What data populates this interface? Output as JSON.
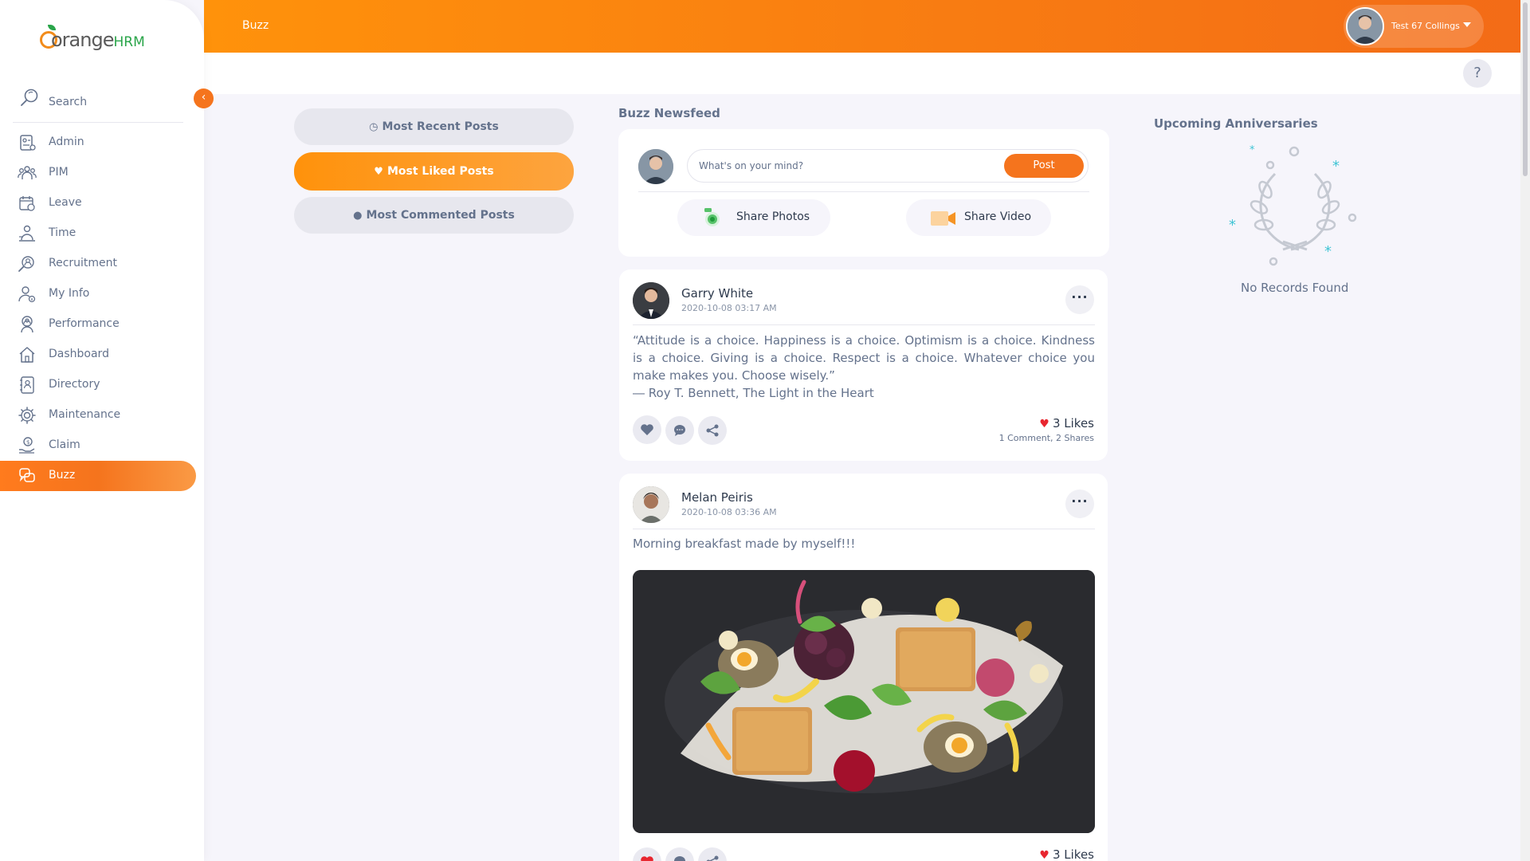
{
  "brand": {
    "logo_text": "orange",
    "logo_suffix": "HRM"
  },
  "sidebar": {
    "search_label": "Search",
    "items": [
      {
        "label": "Admin"
      },
      {
        "label": "PIM"
      },
      {
        "label": "Leave"
      },
      {
        "label": "Time"
      },
      {
        "label": "Recruitment"
      },
      {
        "label": "My Info"
      },
      {
        "label": "Performance"
      },
      {
        "label": "Dashboard"
      },
      {
        "label": "Directory"
      },
      {
        "label": "Maintenance"
      },
      {
        "label": "Claim"
      },
      {
        "label": "Buzz",
        "active": true
      }
    ]
  },
  "topbar": {
    "title": "Buzz",
    "user_name": "Test 67 Collings",
    "help": "?"
  },
  "filters": {
    "recent": "Most Recent Posts",
    "liked": "Most Liked Posts",
    "commented": "Most Commented Posts",
    "active": "liked"
  },
  "newsfeed": {
    "title": "Buzz Newsfeed",
    "placeholder": "What's on your mind?",
    "post_label": "Post",
    "share_photos": "Share Photos",
    "share_video": "Share Video"
  },
  "posts": [
    {
      "author": "Garry White",
      "date": "2020-10-08 03:17 AM",
      "text": "“Attitude is a choice. Happiness is a choice. Optimism is a choice. Kindness is a choice. Giving is a choice. Respect is a choice. Whatever choice you make makes you. Choose wisely.”",
      "attribution": "― Roy T. Bennett, The Light in the Heart",
      "likes": "3 Likes",
      "comments": "1 Comment",
      "shares": "2 Shares"
    },
    {
      "author": "Melan Peiris",
      "date": "2020-10-08 03:36 AM",
      "text": "Morning breakfast made by myself!!!",
      "likes": "3 Likes"
    }
  ],
  "anniversaries": {
    "title": "Upcoming Anniversaries",
    "empty": "No Records Found"
  },
  "colors": {
    "accent": "#f5741d",
    "accent_light": "#ff920b",
    "text": "#64728c",
    "like": "#e8262f"
  }
}
